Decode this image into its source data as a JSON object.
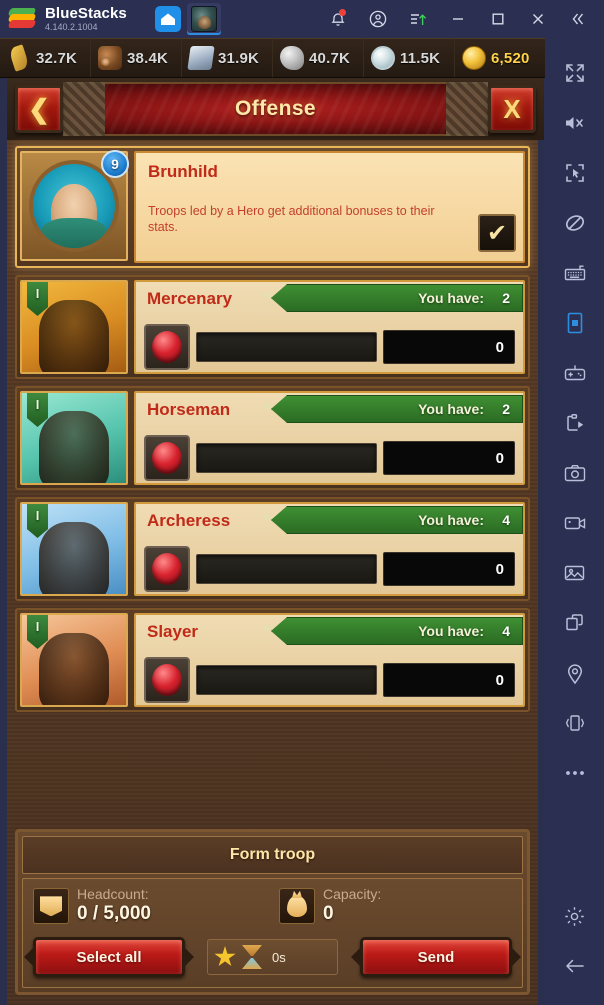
{
  "titlebar": {
    "app_name": "BlueStacks",
    "version": "4.140.2.1004",
    "tabs": [
      {
        "name": "home-tab",
        "icon": "home-icon",
        "label": ""
      },
      {
        "name": "game-tab",
        "icon": "game-thumbnail",
        "label": ""
      }
    ],
    "controls": [
      {
        "name": "notifications-button",
        "icon": "bell-icon"
      },
      {
        "name": "account-button",
        "icon": "account-circle-icon"
      },
      {
        "name": "upload-button",
        "icon": "upload-lines-icon"
      },
      {
        "name": "minimize-button",
        "icon": "minimize-icon"
      },
      {
        "name": "maximize-button",
        "icon": "maximize-icon"
      },
      {
        "name": "close-button",
        "icon": "close-icon"
      },
      {
        "name": "collapse-sidebar-button",
        "icon": "chevrons-left-icon"
      }
    ]
  },
  "resources": [
    {
      "id": "food",
      "icon": "wheat-icon",
      "value": "32.7K"
    },
    {
      "id": "wood",
      "icon": "logs-icon",
      "value": "38.4K"
    },
    {
      "id": "iron",
      "icon": "ingot-icon",
      "value": "31.9K"
    },
    {
      "id": "stone",
      "icon": "stone-icon",
      "value": "40.7K"
    },
    {
      "id": "silver",
      "icon": "silver-coin-icon",
      "value": "11.5K"
    },
    {
      "id": "gold",
      "icon": "gold-coin-icon",
      "value": "6,520"
    }
  ],
  "banner": {
    "title": "Offense",
    "back_label": "❮",
    "close_label": "X"
  },
  "hero": {
    "name": "Brunhild",
    "level": "9",
    "description": "Troops led by a Hero get additional bonuses to their stats.",
    "checkbox_glyph": "✔"
  },
  "troops": [
    {
      "name": "Mercenary",
      "tier": "I",
      "have_label": "You have:",
      "have_count": "2",
      "quantity": "0",
      "portrait": "mercenary-portrait"
    },
    {
      "name": "Horseman",
      "tier": "I",
      "have_label": "You have:",
      "have_count": "2",
      "quantity": "0",
      "portrait": "horseman-portrait"
    },
    {
      "name": "Archeress",
      "tier": "I",
      "have_label": "You have:",
      "have_count": "4",
      "quantity": "0",
      "portrait": "archeress-portrait"
    },
    {
      "name": "Slayer",
      "tier": "I",
      "have_label": "You have:",
      "have_count": "4",
      "quantity": "0",
      "portrait": "slayer-portrait"
    }
  ],
  "form_troop": {
    "title": "Form troop",
    "headcount_label": "Headcount:",
    "headcount_value": "0 / 5,000",
    "capacity_label": "Capacity:",
    "capacity_value": "0",
    "select_all_label": "Select all",
    "send_label": "Send",
    "march_time": "0s"
  },
  "sidebar": {
    "items": [
      {
        "name": "fullscreen-icon",
        "active": false
      },
      {
        "name": "mute-icon",
        "active": false
      },
      {
        "name": "multi-select-icon",
        "active": false
      },
      {
        "name": "no-ads-icon",
        "active": false
      },
      {
        "name": "keyboard-icon",
        "active": false
      },
      {
        "name": "portrait-view-icon",
        "active": true
      },
      {
        "name": "gamepad-icon",
        "active": false
      },
      {
        "name": "macro-play-icon",
        "active": false
      },
      {
        "name": "screenshot-camera-icon",
        "active": false
      },
      {
        "name": "video-record-icon",
        "active": false
      },
      {
        "name": "media-gallery-icon",
        "active": false
      },
      {
        "name": "multi-instance-icon",
        "active": false
      },
      {
        "name": "location-pin-icon",
        "active": false
      },
      {
        "name": "shake-device-icon",
        "active": false
      },
      {
        "name": "more-options-icon",
        "active": false
      }
    ],
    "bottom_items": [
      {
        "name": "settings-gear-icon",
        "active": false
      },
      {
        "name": "back-arrow-icon",
        "active": false
      }
    ]
  },
  "colors": {
    "accent_blue": "#2f8de0",
    "banner_red": "#8e1616",
    "gold_text": "#ffd24a",
    "ribbon_green": "#3f8f33",
    "troop_name_red": "#c02a18"
  }
}
